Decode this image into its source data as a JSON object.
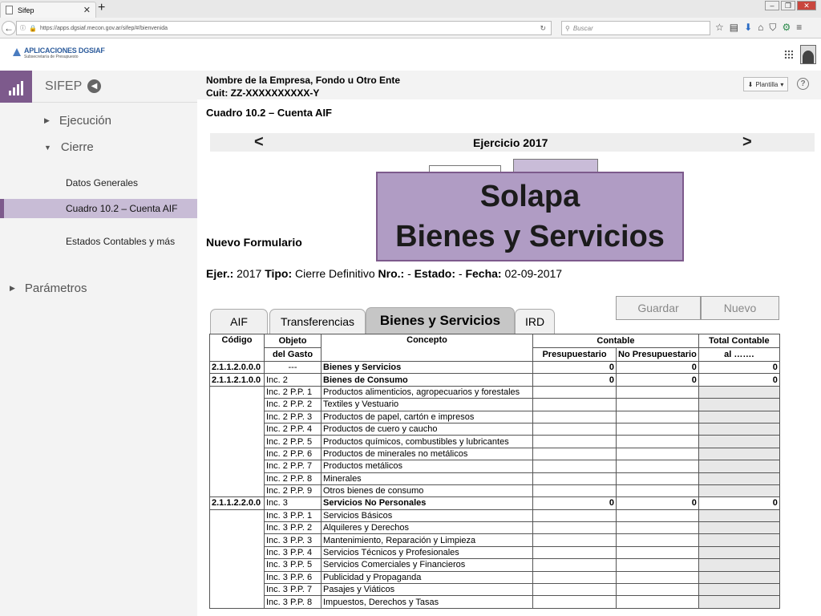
{
  "browser": {
    "tab_title": "Sifep",
    "url": "https://apps.dgsiaf.mecon.gov.ar/sifep/#/bienvenida",
    "search_placeholder": "Buscar"
  },
  "app": {
    "logo_title": "APLICACIONES DGSIAF",
    "logo_subtitle": "Subsecretaría de Presupuesto"
  },
  "sidebar": {
    "title": "SIFEP",
    "menu": [
      {
        "label": "Ejecución",
        "icon": "triangle-right-icon"
      },
      {
        "label": "Cierre",
        "icon": "triangle-down-icon"
      }
    ],
    "sub_items": [
      "Datos Generales",
      "Cuadro 10.2  – Cuenta AIF",
      "Estados Contables y más"
    ],
    "params_label": "Parámetros"
  },
  "header": {
    "company": "Nombre de la Empresa, Fondo u Otro Ente",
    "cuit": "Cuit: ZZ-XXXXXXXXXX-Y",
    "plantilla_label": "Plantilla",
    "cuadro_title": "Cuadro 10.2  – Cuenta AIF"
  },
  "ejercicio": {
    "prev": "<",
    "label": "Ejercicio 2017",
    "next": ">"
  },
  "callout": {
    "line1": "Solapa",
    "line2": "Bienes y Servicios"
  },
  "form": {
    "title": "Nuevo Formulario",
    "ejer_label": "Ejer.:",
    "ejer_value": "2017",
    "tipo_label": "Tipo:",
    "tipo_value": "Cierre Definitivo",
    "nro_label": "Nro.:",
    "nro_value": "-",
    "estado_label": "Estado:",
    "estado_value": "-",
    "fecha_label": "Fecha:",
    "fecha_value": "02-09-2017",
    "save_label": "Guardar",
    "new_label": "Nuevo"
  },
  "tabs": [
    "AIF",
    "Transferencias",
    "Bienes y Servicios",
    "IRD"
  ],
  "table": {
    "headers": {
      "codigo": "Código",
      "objeto1": "Objeto",
      "objeto2": "del Gasto",
      "concepto": "Concepto",
      "contable": "Contable",
      "presupuestario": "Presupuestario",
      "no_presupuestario": "No Presupuestario",
      "total1": "Total Contable",
      "total2": "al ……."
    },
    "rows": [
      {
        "code": "2.1.1.2.0.0.0",
        "objeto": "---",
        "concepto": "Bienes y Servicios",
        "bold": true,
        "p": "0",
        "np": "0",
        "t": "0"
      },
      {
        "code": "2.1.1.2.1.0.0",
        "objeto": "Inc. 2",
        "concepto": "Bienes de Consumo",
        "bold": true,
        "p": "0",
        "np": "0",
        "t": "0"
      },
      {
        "code": "",
        "objeto": "Inc. 2 P.P. 1",
        "concepto": "Productos alimenticios, agropecuarios y forestales"
      },
      {
        "code": "",
        "objeto": "Inc. 2 P.P. 2",
        "concepto": "Textiles y Vestuario"
      },
      {
        "code": "",
        "objeto": "Inc. 2 P.P. 3",
        "concepto": "Productos de papel, cartón e impresos"
      },
      {
        "code": "",
        "objeto": "Inc. 2 P.P. 4",
        "concepto": "Productos de cuero y caucho"
      },
      {
        "code": "",
        "objeto": "Inc. 2 P.P. 5",
        "concepto": "Productos químicos, combustibles y lubricantes"
      },
      {
        "code": "",
        "objeto": "Inc. 2 P.P. 6",
        "concepto": "Productos de minerales no metálicos"
      },
      {
        "code": "",
        "objeto": "Inc. 2 P.P. 7",
        "concepto": "Productos metálicos"
      },
      {
        "code": "",
        "objeto": "Inc. 2 P.P. 8",
        "concepto": "Minerales"
      },
      {
        "code": "",
        "objeto": "Inc. 2 P.P. 9",
        "concepto": "Otros bienes de consumo"
      },
      {
        "code": "2.1.1.2.2.0.0",
        "objeto": "Inc. 3",
        "concepto": "Servicios No Personales",
        "bold": true,
        "p": "0",
        "np": "0",
        "t": "0"
      },
      {
        "code": "",
        "objeto": "Inc. 3 P.P. 1",
        "concepto": "Servicios Básicos"
      },
      {
        "code": "",
        "objeto": "Inc. 3 P.P. 2",
        "concepto": "Alquileres y Derechos"
      },
      {
        "code": "",
        "objeto": "Inc. 3 P.P. 3",
        "concepto": "Mantenimiento, Reparación y Limpieza"
      },
      {
        "code": "",
        "objeto": "Inc. 3 P.P. 4",
        "concepto": "Servicios Técnicos y Profesionales"
      },
      {
        "code": "",
        "objeto": "Inc. 3 P.P. 5",
        "concepto": "Servicios Comerciales y Financieros"
      },
      {
        "code": "",
        "objeto": "Inc. 3 P.P. 6",
        "concepto": "Publicidad y Propaganda"
      },
      {
        "code": "",
        "objeto": "Inc. 3 P.P. 7",
        "concepto": "Pasajes y Viáticos"
      },
      {
        "code": "",
        "objeto": "Inc. 3 P.P. 8",
        "concepto": "Impuestos, Derechos y Tasas"
      }
    ]
  }
}
